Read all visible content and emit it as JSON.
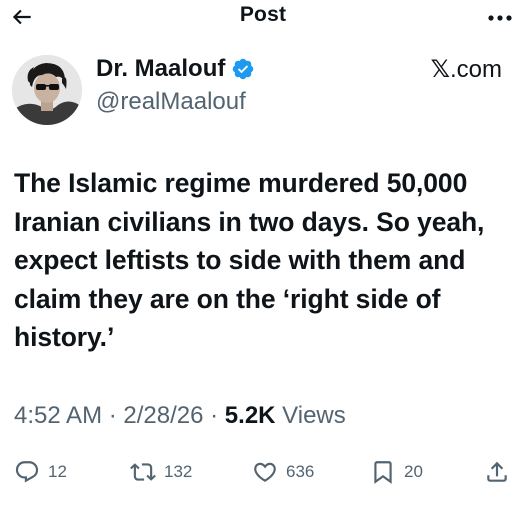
{
  "header": {
    "title": "Post",
    "back_icon": "arrow-left-icon",
    "more_icon": "more-horizontal-icon"
  },
  "author": {
    "name": "Dr. Maalouf",
    "handle": "@realMaalouf",
    "verified": true,
    "verified_color": "#1d9bf0"
  },
  "watermark": {
    "glyph": "𝕏",
    "text": ".com"
  },
  "post": {
    "text": "The Islamic regime murdered 50,000 Iranian civilians in two days. So yeah, expect leftists to side with them and claim they are on the ‘right side of history.’"
  },
  "meta": {
    "time": "4:52 AM",
    "separator": " · ",
    "date": "2/28/26",
    "views_count": "5.2K",
    "views_label": " Views"
  },
  "actions": {
    "replies": "12",
    "reposts": "132",
    "likes": "636",
    "bookmarks": "20"
  },
  "colors": {
    "text": "#0f1419",
    "secondary": "#536471",
    "accent": "#1d9bf0"
  }
}
